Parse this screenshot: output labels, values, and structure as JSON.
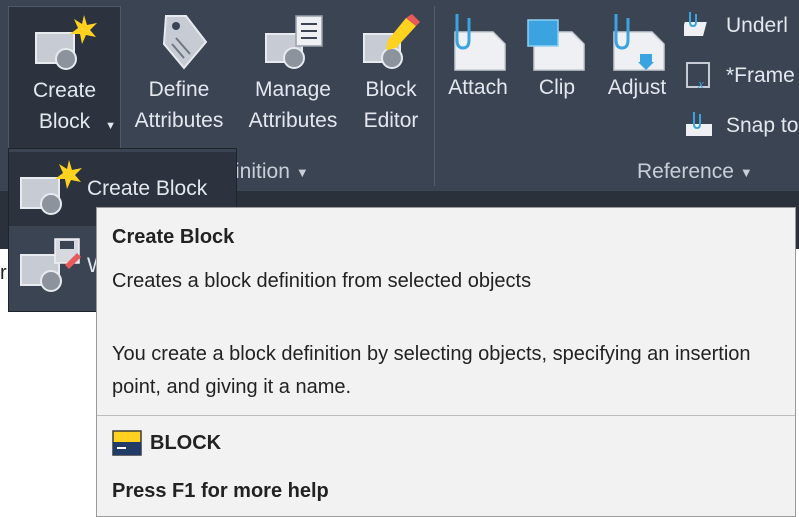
{
  "ribbon": {
    "tools": [
      {
        "id": "create-block",
        "label": "Create\nBlock",
        "icon": "create-block-icon"
      },
      {
        "id": "define-attributes",
        "label": "Define\nAttributes",
        "icon": "tag-icon"
      },
      {
        "id": "manage-attributes",
        "label": "Manage\nAttributes",
        "icon": "manage-attributes-icon"
      },
      {
        "id": "block-editor",
        "label": "Block\nEditor",
        "icon": "block-editor-icon"
      },
      {
        "id": "attach",
        "label": "Attach",
        "icon": "paperclip-document-icon"
      },
      {
        "id": "clip",
        "label": "Clip",
        "icon": "clip-icon"
      },
      {
        "id": "adjust",
        "label": "Adjust",
        "icon": "adjust-icon"
      }
    ],
    "side_items": [
      {
        "id": "underlay",
        "label": "Underl",
        "icon": "underlay-icon"
      },
      {
        "id": "frame",
        "label": "*Frame",
        "icon": "frame-icon"
      },
      {
        "id": "snap",
        "label": "Snap to",
        "icon": "snap-icon"
      }
    ],
    "panels": [
      {
        "id": "block-definition",
        "title": "inition"
      },
      {
        "id": "reference",
        "title": "Reference"
      }
    ]
  },
  "flyout": {
    "items": [
      {
        "label": "Create Block",
        "icon": "create-block-icon"
      },
      {
        "label": "W",
        "icon": "write-block-icon"
      }
    ]
  },
  "left_fragment": "r",
  "tooltip": {
    "title": "Create Block",
    "description": "Creates a block definition from selected objects",
    "detail": "You create a block definition by selecting objects, specifying an insertion point, and giving it a name.",
    "command": "BLOCK",
    "help": "Press F1 for more help"
  },
  "colors": {
    "ribbon_bg": "#3b4453",
    "ribbon_active": "#2c333e",
    "text_light": "#e4e8ee",
    "tooltip_bg": "#f2f2f2",
    "accent_yellow": "#ffd21f",
    "icon_blue": "#3aa3e0"
  }
}
